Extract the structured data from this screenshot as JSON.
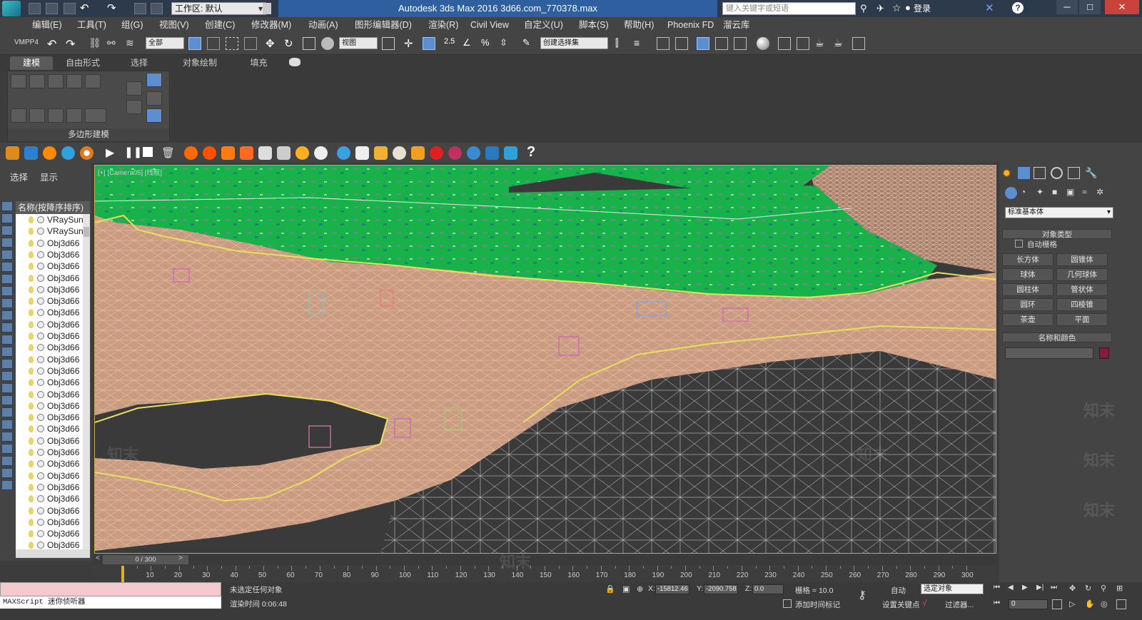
{
  "titlebar": {
    "title": "Autodesk 3ds Max 2016    3d66.com_770378.max",
    "workspace": "工作区: 默认",
    "search_placeholder": "键入关键字或短语",
    "login": "登录",
    "window_controls": [
      "minimize-icon",
      "maximize-icon",
      "close-icon"
    ]
  },
  "menubar": {
    "items": [
      "编辑(E)",
      "工具(T)",
      "组(G)",
      "视图(V)",
      "创建(C)",
      "修改器(M)",
      "动画(A)",
      "图形编辑器(D)",
      "渲染(R)",
      "Civil View",
      "自定义(U)",
      "脚本(S)",
      "帮助(H)",
      "Phoenix FD",
      "溜云库"
    ]
  },
  "toolbar": {
    "vmpp": "VMPP4",
    "filter_select": "全部",
    "refcoord_select": "视图",
    "snap_label": "2.5",
    "named_selection": "创建选择集"
  },
  "ribbon": {
    "tabs": [
      "建模",
      "自由形式",
      "选择",
      "对象绘制",
      "填充"
    ],
    "panel_label": "多边形建模"
  },
  "explorer": {
    "tabs": [
      "选择",
      "显示"
    ],
    "header": "名称(按降序排序)",
    "rows": [
      "VRaySun",
      "VRaySun",
      "Obj3d66",
      "Obj3d66",
      "Obj3d66",
      "Obj3d66",
      "Obj3d66",
      "Obj3d66",
      "Obj3d66",
      "Obj3d66",
      "Obj3d66",
      "Obj3d66",
      "Obj3d66",
      "Obj3d66",
      "Obj3d66",
      "Obj3d66",
      "Obj3d66",
      "Obj3d66",
      "Obj3d66",
      "Obj3d66",
      "Obj3d66",
      "Obj3d66",
      "Obj3d66",
      "Obj3d66",
      "Obj3d66",
      "Obj3d66",
      "Obj3d66",
      "Obj3d66",
      "Obj3d66"
    ]
  },
  "viewport": {
    "label": "[+] [Camera05] [线框]"
  },
  "command_panel": {
    "category": "标准基本体",
    "object_type_title": "对象类型",
    "autogrid": "自动栅格",
    "buttons": [
      "长方体",
      "圆锥体",
      "球体",
      "几何球体",
      "圆柱体",
      "管状体",
      "圆环",
      "四棱锥",
      "茶壶",
      "平面"
    ],
    "name_color_title": "名称和颜色",
    "swatch_color": "#8a1838"
  },
  "timeline": {
    "frame_display": "0 / 300",
    "ticks": [
      "10",
      "20",
      "30",
      "40",
      "50",
      "60",
      "70",
      "80",
      "90",
      "100",
      "110",
      "120",
      "130",
      "140",
      "150",
      "160",
      "170",
      "180",
      "190",
      "200",
      "210",
      "220",
      "230",
      "240",
      "250",
      "260",
      "270",
      "280",
      "290",
      "300"
    ]
  },
  "status": {
    "listener": "MAXScript 迷你侦听器",
    "selection": "未选定任何对象",
    "render_time": "渲染时间 0:06:48",
    "x_label": "X:",
    "x_value": "-15812.46",
    "y_label": "Y:",
    "y_value": "-2090.758",
    "z_label": "Z:",
    "z_value": "0.0",
    "grid": "栅格 = 10.0",
    "add_time_tag": "添加时间标记",
    "auto": "自动",
    "set_key": "设置关键点",
    "selected_object": "选定对象",
    "filters": "过滤器...",
    "current_frame": "0"
  },
  "watermark": "知末",
  "colors": {
    "terrain_green": "#19b24a",
    "wire_peach": "#f0b899",
    "road_yellow": "#e6e05a",
    "viewport_border": "#c8a840",
    "title_blue": "#2f5f9e"
  }
}
